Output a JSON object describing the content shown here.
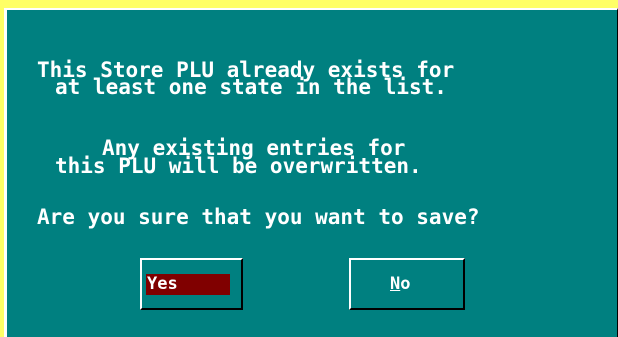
{
  "dialog": {
    "message_lines": [
      "This Store PLU already exists for",
      "at least one state in the list.",
      "Any existing entries for",
      "this PLU will be overwritten.",
      "Are you sure that you want to save?"
    ]
  },
  "buttons": {
    "yes_label": "Yes",
    "no_label": "No",
    "no_mnemonic": "N",
    "no_rest": "o"
  },
  "colors": {
    "background": "#ffff66",
    "dialog": "#008080",
    "focused_button": "#800000",
    "text": "#ffffff"
  }
}
